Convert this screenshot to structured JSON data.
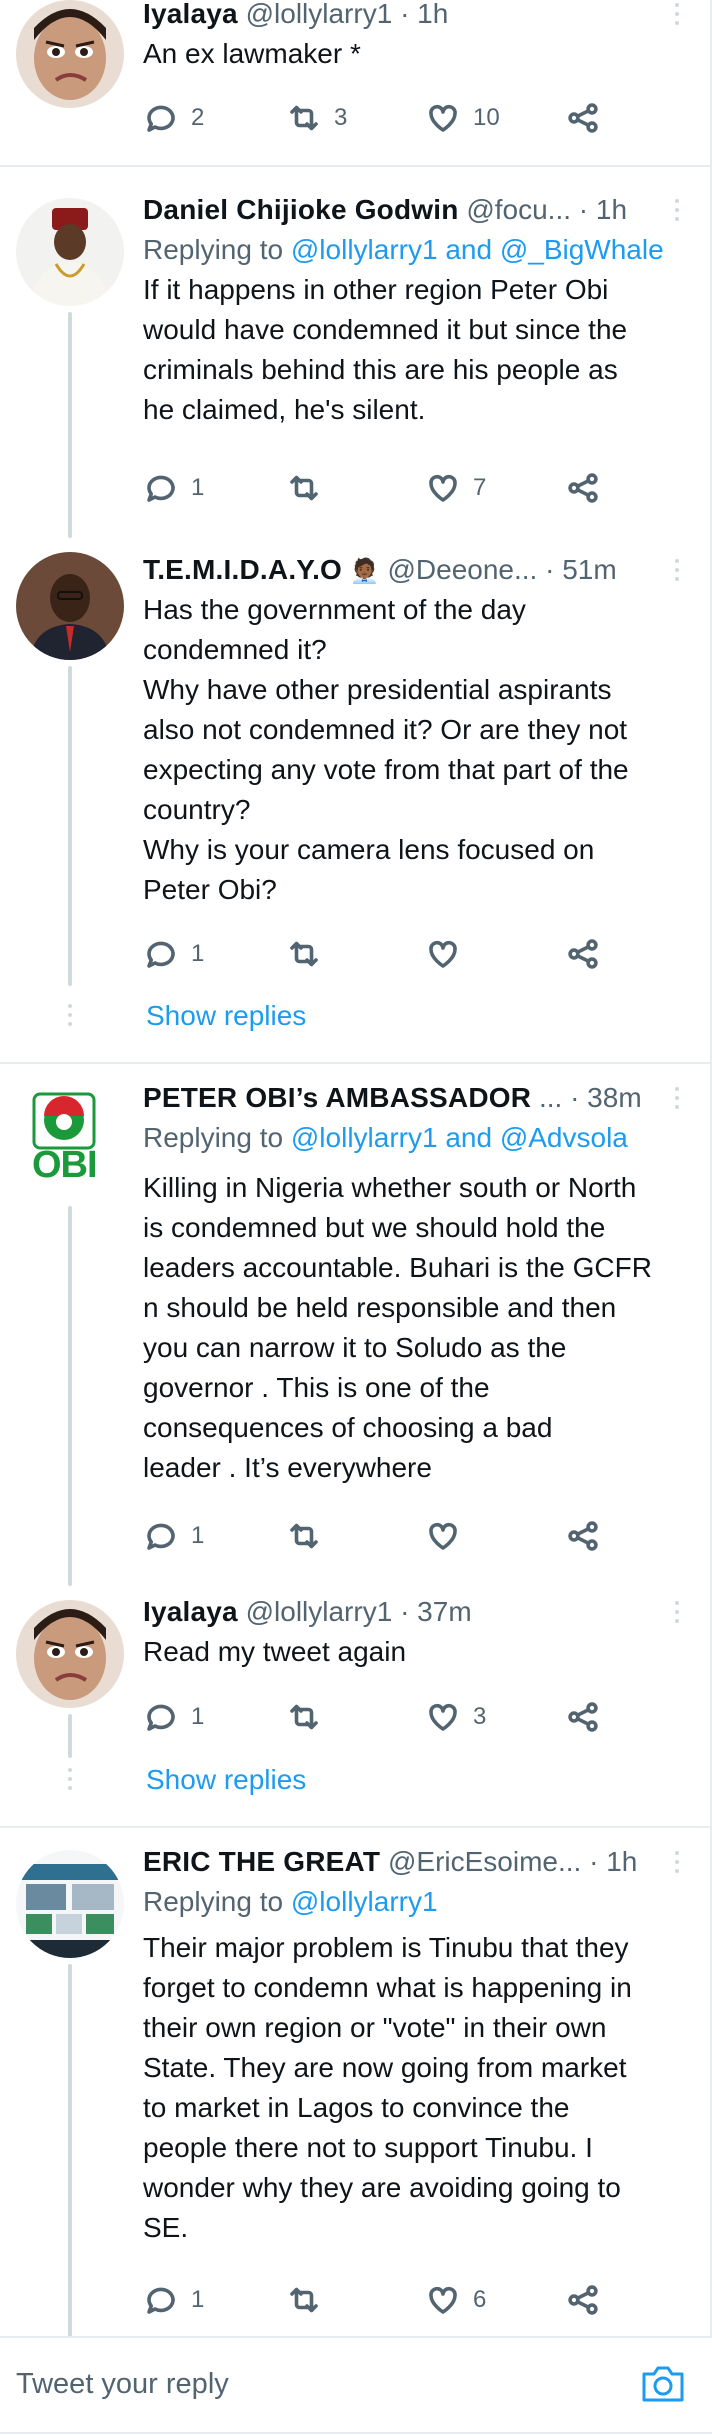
{
  "tweets": [
    {
      "name": "Iyalaya",
      "handle": "@lollylarry1",
      "dot": "·",
      "time": "1h",
      "reply_to": null,
      "text": [
        "An ex lawmaker *"
      ],
      "replies": "2",
      "retweets": "3",
      "likes": "10"
    },
    {
      "name": "Daniel Chijioke Godwin",
      "handle": "@focu...",
      "dot": "·",
      "time": "1h",
      "reply_to": {
        "prefix": "Replying to ",
        "link": "@lollylarry1 and @_BigWhale"
      },
      "text": [
        "If it happens in other region Peter Obi",
        "would have condemned it but since the",
        "criminals behind this are his people as",
        "he claimed, he's silent."
      ],
      "replies": "1",
      "retweets": "",
      "likes": "7"
    },
    {
      "name": "T.E.M.I.D.A.Y.O",
      "emoji": "🧑🏾‍💼",
      "handle": "@Deeone...",
      "dot": "·",
      "time": "51m",
      "reply_to": null,
      "text": [
        "Has the government of the day",
        "condemned it?",
        "Why have other presidential aspirants",
        "also not condemned it? Or are they not",
        "expecting any vote from that part of the",
        "country?",
        "Why is your camera lens focused on",
        "Peter Obi?"
      ],
      "replies": "1",
      "retweets": "",
      "likes": ""
    },
    {
      "name": "PETER OBI’s AMBASSADOR",
      "handle": "...",
      "dot": "·",
      "time": "38m",
      "reply_to": {
        "prefix": "Replying to ",
        "link": "@lollylarry1 and @Advsola"
      },
      "text": [
        "Killing in Nigeria whether south or North",
        "is condemned but we should hold the",
        "leaders accountable. Buhari is the GCFR",
        "n should be held responsible and then",
        "you can narrow it to Soludo as the",
        "governor . This is one of the",
        "consequences of choosing a bad",
        "leader . It’s everywhere"
      ],
      "replies": "1",
      "retweets": "",
      "likes": "",
      "avatar_text": "OBI"
    },
    {
      "name": "Iyalaya",
      "handle": "@lollylarry1",
      "dot": "·",
      "time": "37m",
      "reply_to": null,
      "text": [
        "Read my tweet again"
      ],
      "replies": "1",
      "retweets": "",
      "likes": "3"
    },
    {
      "name": "ERIC THE GREAT",
      "handle": "@EricEsoime...",
      "dot": "·",
      "time": "1h",
      "reply_to": {
        "prefix": "Replying to ",
        "link": "@lollylarry1"
      },
      "text": [
        "Their major problem is Tinubu that they",
        "forget to condemn what is happening in",
        "their own region or \"vote\" in their own",
        "State. They are now going from market",
        "to market in Lagos to convince the",
        "people there not to support Tinubu. I",
        "wonder why they are avoiding going to",
        "SE."
      ],
      "replies": "1",
      "retweets": "",
      "likes": "6"
    }
  ],
  "show_replies_label": "Show replies",
  "composer": {
    "placeholder": "Tweet your reply"
  },
  "icons": {
    "reply": "reply-icon",
    "retweet": "retweet-icon",
    "like": "heart-icon",
    "share": "share-icon",
    "more": "more-icon",
    "camera": "camera-icon"
  },
  "colors": {
    "link": "#1d9bf0",
    "muted": "#536471",
    "obi_green": "#1a9a3a",
    "obi_red": "#d7262e"
  }
}
